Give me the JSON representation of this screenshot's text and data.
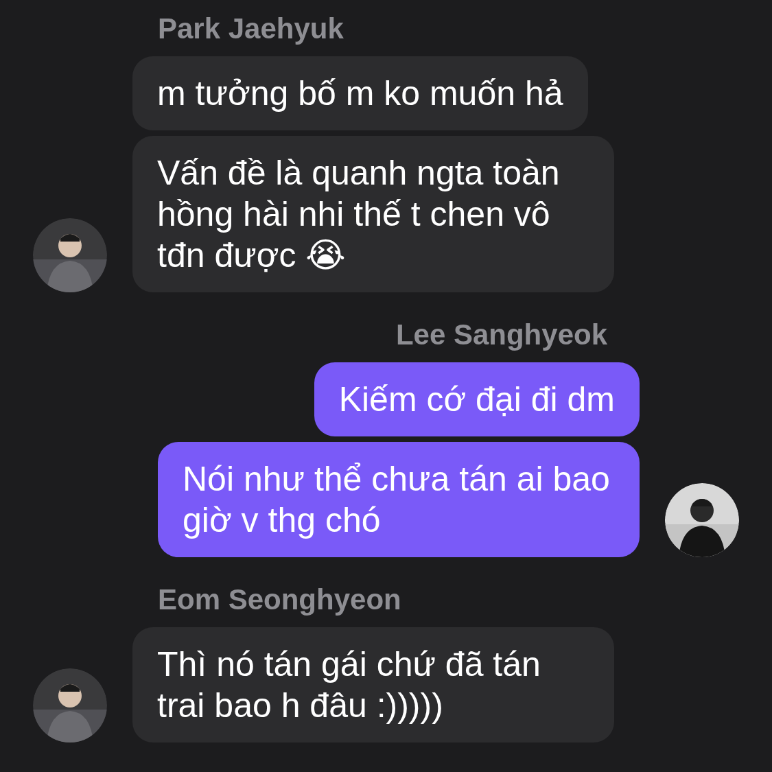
{
  "groups": [
    {
      "kind": "incoming",
      "sender": "Park Jaehyuk",
      "messages": [
        "m tưởng bố m ko muốn hả",
        "Vấn đề là quanh ngta toàn hồng hài nhi thế t chen vô tđn được 😭"
      ]
    },
    {
      "kind": "outgoing",
      "sender": "Lee Sanghyeok",
      "messages": [
        "Kiếm cớ đại đi dm",
        "Nói như thể chưa tán ai bao giờ v thg chó"
      ]
    },
    {
      "kind": "incoming",
      "sender": "Eom Seonghyeon",
      "messages": [
        "Thì nó tán gái chứ đã tán trai bao h đâu :)))))"
      ]
    }
  ]
}
